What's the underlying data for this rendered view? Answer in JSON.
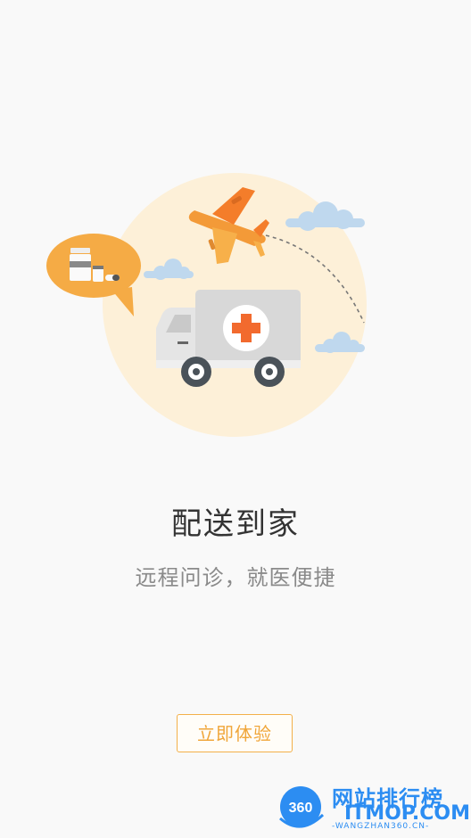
{
  "onboarding": {
    "title": "配送到家",
    "subtitle": "远程问诊，就医便捷",
    "cta_label": "立即体验"
  },
  "watermark": {
    "logo_text": "360",
    "brand": "网站排行榜",
    "domain": "ITMOP.COM",
    "sub_domain": "-WANGZHAN360.CN-"
  },
  "colors": {
    "background": "#f9f9f9",
    "accent": "#f0a63a",
    "circle": "#fdf0d8",
    "watermark_blue": "#2c8df2"
  },
  "icons": [
    "airplane-icon",
    "medicine-bubble-icon",
    "ambulance-truck-icon",
    "cloud-icon",
    "medical-cross-icon"
  ]
}
